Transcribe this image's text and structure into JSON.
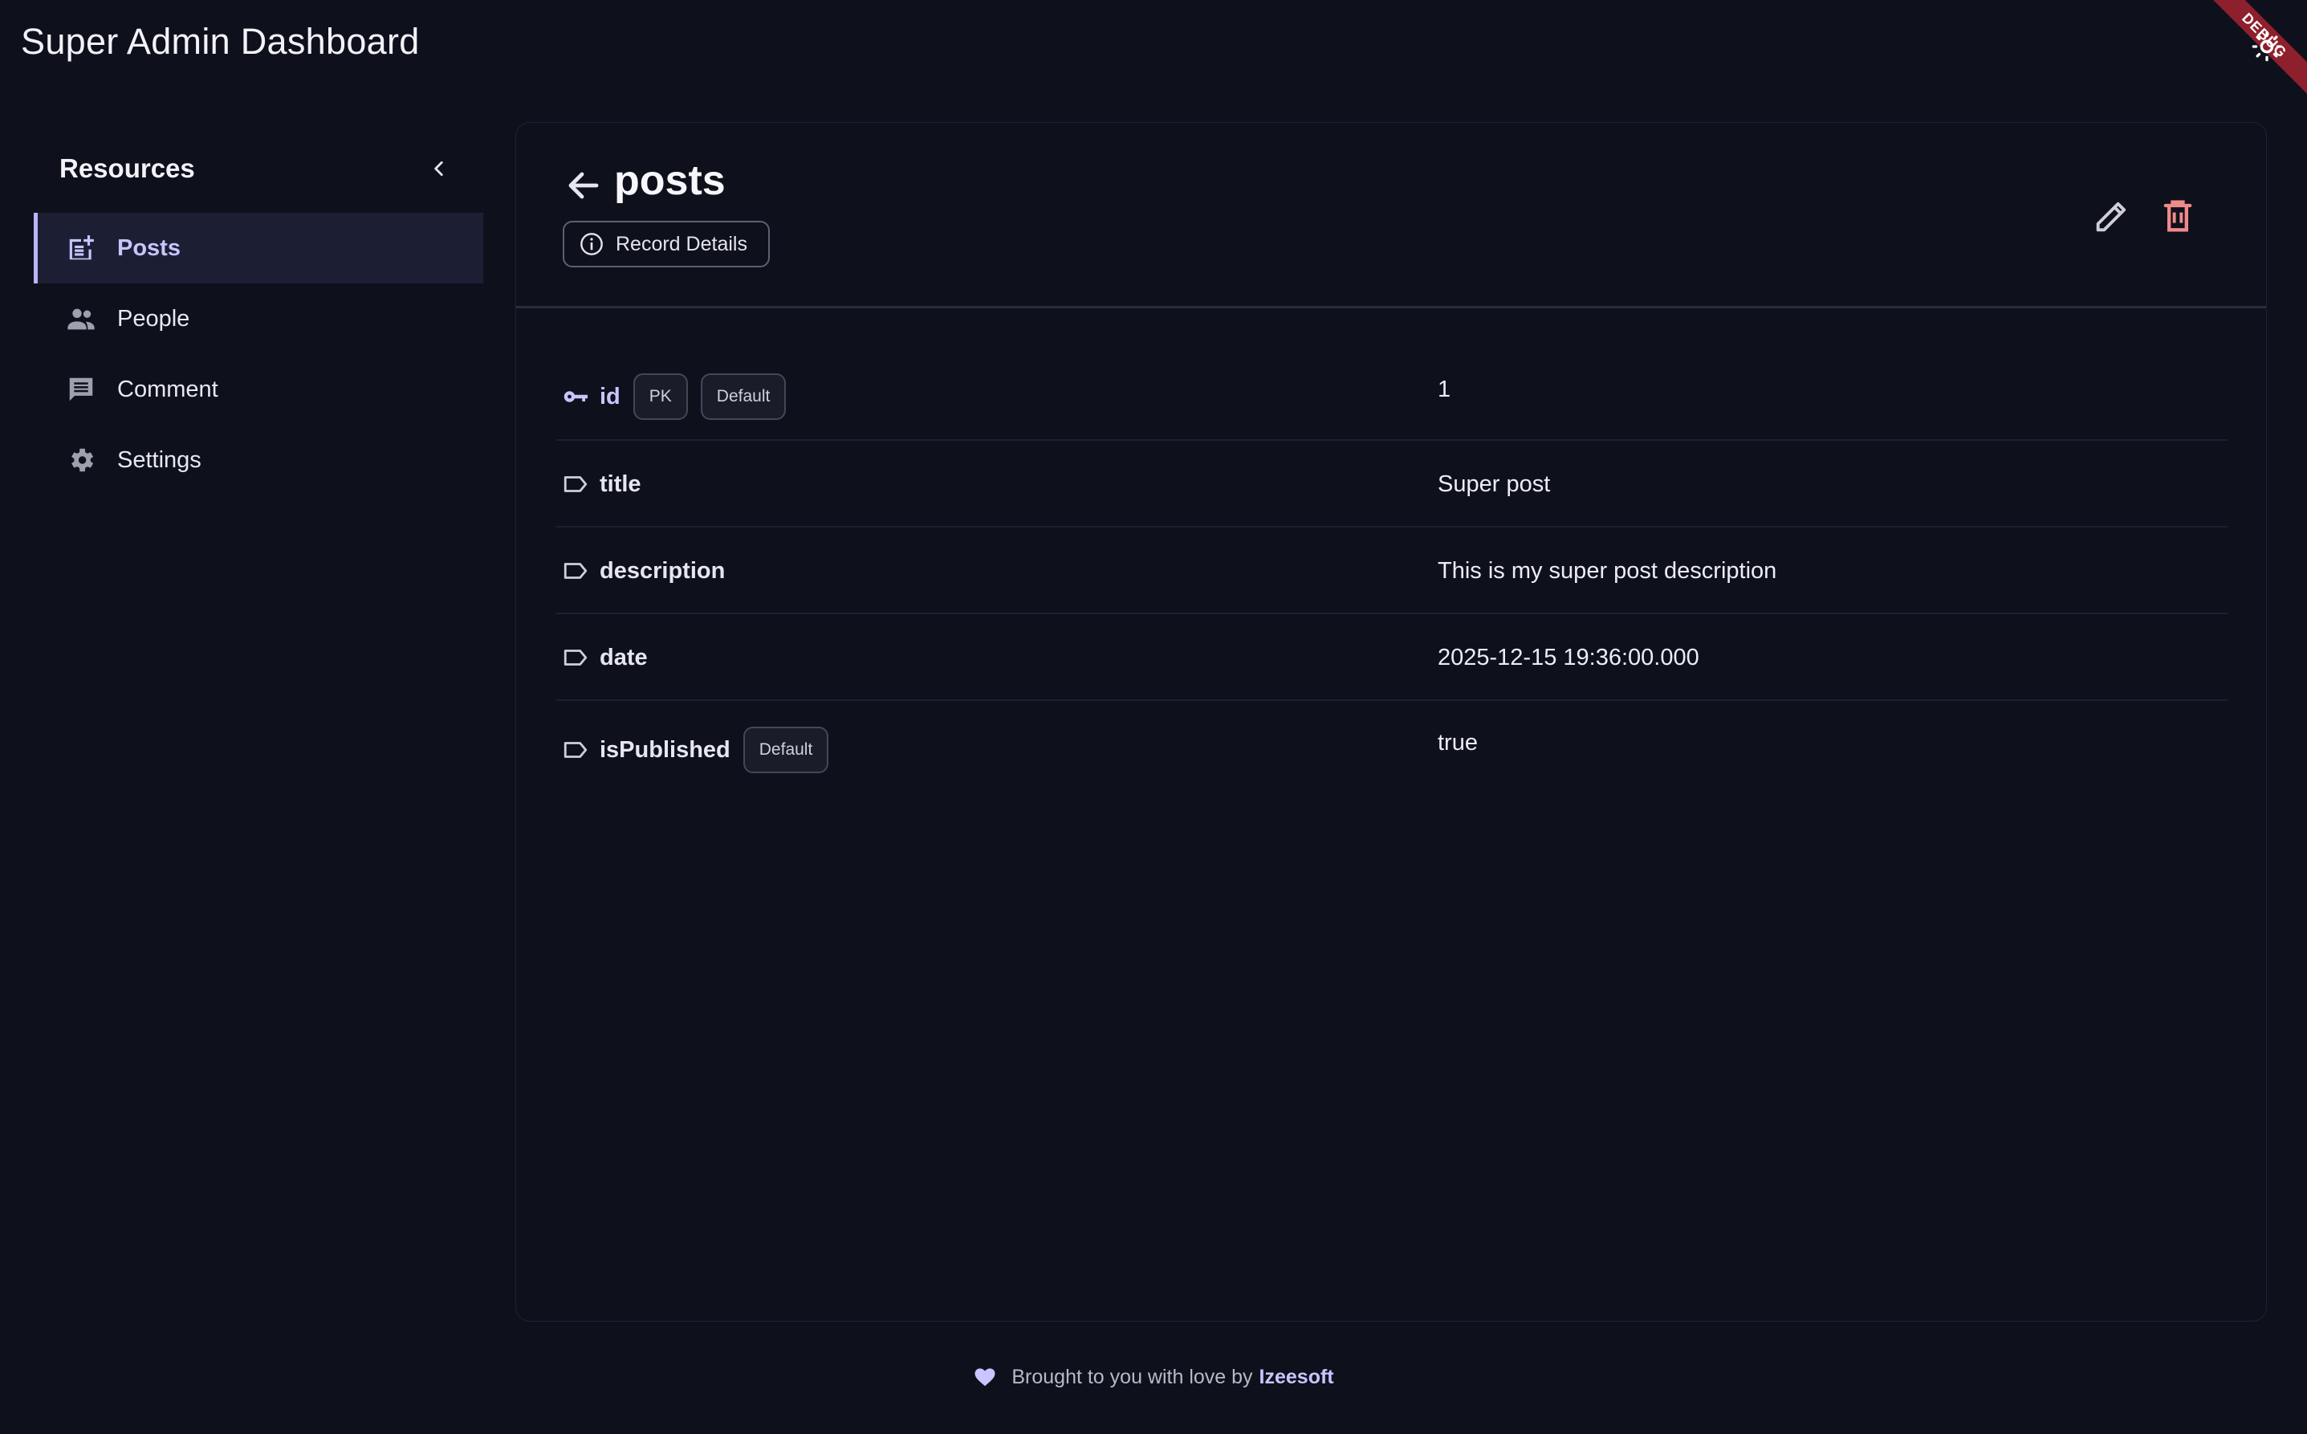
{
  "app": {
    "title": "Super Admin Dashboard",
    "debug_label": "DEBUG"
  },
  "sidebar": {
    "title": "Resources",
    "items": [
      {
        "label": "Posts",
        "icon": "post-add-icon",
        "active": true
      },
      {
        "label": "People",
        "icon": "people-icon",
        "active": false
      },
      {
        "label": "Comment",
        "icon": "comment-icon",
        "active": false
      },
      {
        "label": "Settings",
        "icon": "gear-icon",
        "active": false
      }
    ]
  },
  "record": {
    "title": "posts",
    "details_chip": "Record Details",
    "fields": [
      {
        "name": "id",
        "icon": "key-icon",
        "badges": [
          "PK",
          "Default"
        ],
        "value": "1"
      },
      {
        "name": "title",
        "icon": "label-icon",
        "badges": [],
        "value": "Super post"
      },
      {
        "name": "description",
        "icon": "label-icon",
        "badges": [],
        "value": "This is my super post description"
      },
      {
        "name": "date",
        "icon": "label-icon",
        "badges": [],
        "value": "2025-12-15 19:36:00.000"
      },
      {
        "name": "isPublished",
        "icon": "label-icon",
        "badges": [
          "Default"
        ],
        "value": "true"
      }
    ]
  },
  "footer": {
    "text": "Brought to you with love by",
    "brand": "Izeesoft"
  },
  "colors": {
    "background": "#0e101c",
    "accent": "#c8c5ff",
    "danger": "#f08a8a"
  }
}
